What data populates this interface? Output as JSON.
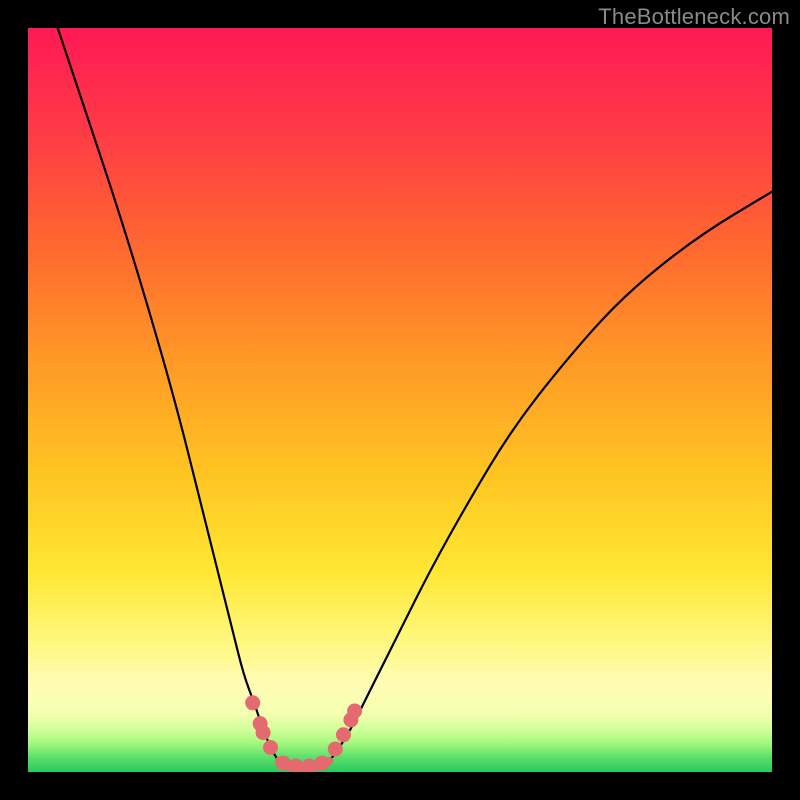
{
  "watermark": "TheBottleneck.com",
  "chart_data": {
    "type": "line",
    "title": "",
    "xlabel": "",
    "ylabel": "",
    "xlim": [
      0,
      100
    ],
    "ylim": [
      0,
      100
    ],
    "grid": false,
    "series": [
      {
        "name": "curve-left",
        "x": [
          4,
          8,
          12,
          16,
          20,
          23,
          25.5,
          27.5,
          29,
          30.5,
          31.5,
          32.3,
          33,
          33.7
        ],
        "y": [
          100,
          88,
          76,
          63,
          49,
          37,
          27,
          19,
          13,
          9,
          6,
          4,
          2.5,
          1.5
        ]
      },
      {
        "name": "curve-right",
        "x": [
          40.5,
          41.3,
          42.3,
          43.5,
          45,
          47,
          50,
          54,
          59,
          65,
          72,
          80,
          90,
          100
        ],
        "y": [
          1.5,
          2.5,
          4,
          6,
          9,
          13,
          19,
          27,
          36,
          46,
          55,
          64,
          72,
          78
        ]
      },
      {
        "name": "valley-floor",
        "x": [
          33.7,
          34.5,
          36,
          38,
          39.5,
          40.5
        ],
        "y": [
          1.5,
          0.8,
          0.5,
          0.5,
          0.8,
          1.5
        ]
      }
    ],
    "markers": [
      {
        "name": "left-upper-dot",
        "x": 30.2,
        "y": 9.3
      },
      {
        "name": "left-dot-a",
        "x": 31.2,
        "y": 6.5
      },
      {
        "name": "left-dot-b",
        "x": 31.6,
        "y": 5.3
      },
      {
        "name": "left-lower-dot",
        "x": 32.6,
        "y": 3.3
      },
      {
        "name": "floor-dot-a",
        "x": 34.3,
        "y": 1.2
      },
      {
        "name": "floor-dot-b",
        "x": 36.0,
        "y": 0.8
      },
      {
        "name": "floor-dot-c",
        "x": 37.8,
        "y": 0.8
      },
      {
        "name": "floor-dot-d",
        "x": 39.5,
        "y": 1.2
      },
      {
        "name": "right-lower-dot",
        "x": 41.3,
        "y": 3.1
      },
      {
        "name": "right-mid-dot",
        "x": 42.4,
        "y": 5.0
      },
      {
        "name": "right-dot-a",
        "x": 43.4,
        "y": 7.0
      },
      {
        "name": "right-dot-b",
        "x": 43.9,
        "y": 8.2
      }
    ],
    "marker_color": "#e46a6f",
    "curve_color": "#000000"
  }
}
